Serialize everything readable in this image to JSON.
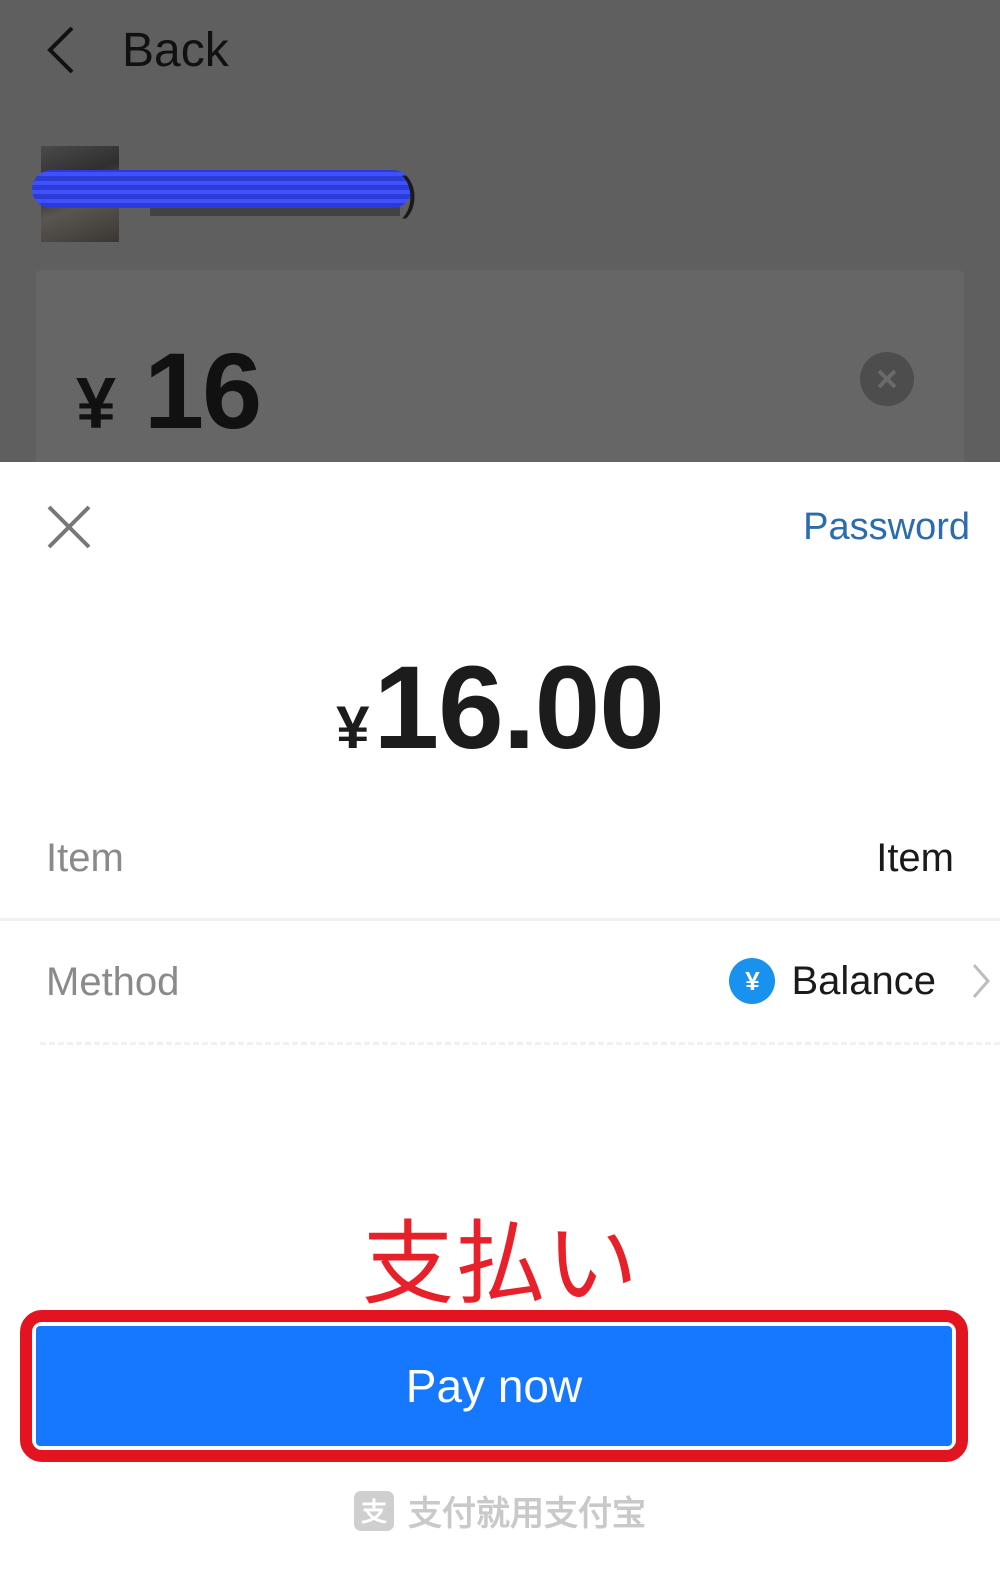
{
  "background": {
    "back_label": "Back",
    "merchant_paren": ")",
    "amount_currency": "¥",
    "amount_value": "16"
  },
  "sheet": {
    "password_link": "Password",
    "total_currency": "¥",
    "total_value": "16.00",
    "rows": [
      {
        "label": "Item",
        "value": "Item"
      },
      {
        "label": "Method",
        "value": "Balance",
        "icon": "¥"
      }
    ],
    "annotation": "支払い",
    "pay_button": "Pay now",
    "footer_icon": "支",
    "footer_text": "支付就用支付宝"
  },
  "colors": {
    "primary": "#1677ff",
    "link": "#2b6cb0",
    "annotation": "#e3141f",
    "balance_icon": "#1891ef"
  }
}
